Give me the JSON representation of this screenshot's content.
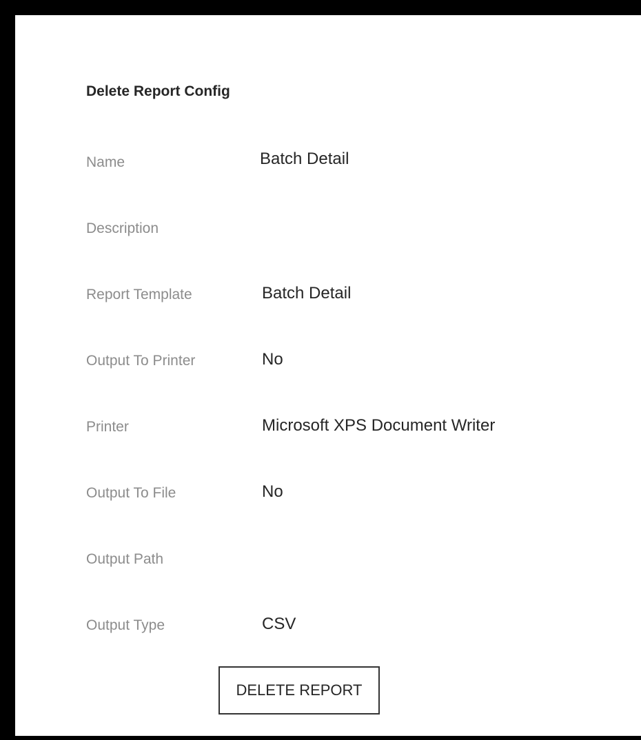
{
  "form": {
    "title": "Delete Report Config",
    "fields": [
      {
        "label": "Name",
        "value": "Batch Detail"
      },
      {
        "label": "Description",
        "value": ""
      },
      {
        "label": "Report Template",
        "value": "Batch Detail"
      },
      {
        "label": "Output To Printer",
        "value": "No"
      },
      {
        "label": "Printer",
        "value": "Microsoft XPS Document Writer"
      },
      {
        "label": "Output To File",
        "value": "No"
      },
      {
        "label": "Output Path",
        "value": ""
      },
      {
        "label": "Output Type",
        "value": "CSV"
      }
    ],
    "delete_button_label": "DELETE REPORT"
  }
}
